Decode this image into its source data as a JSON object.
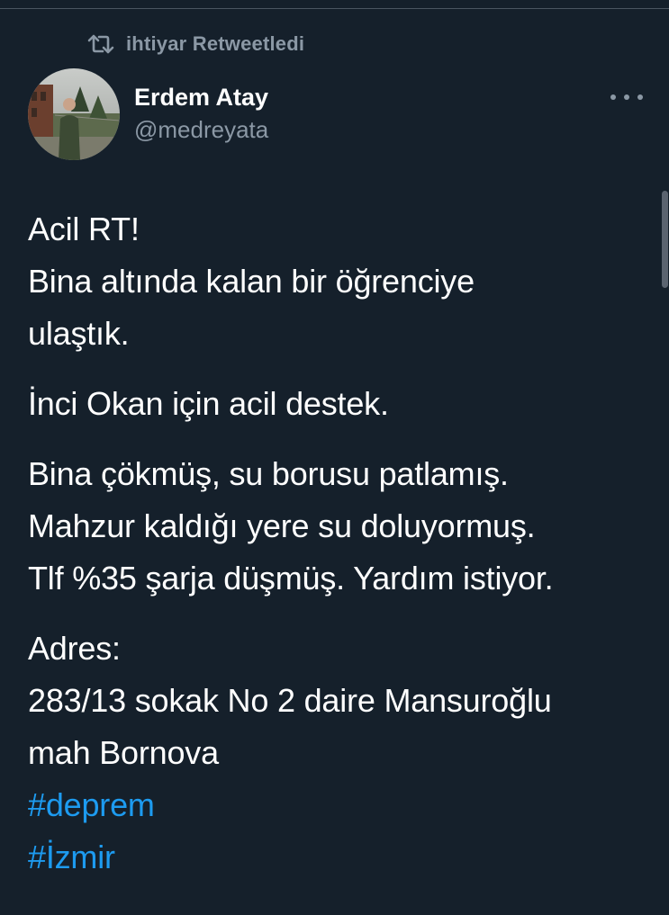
{
  "retweet": {
    "icon": "retweet-icon",
    "label": "ihtiyar Retweetledi"
  },
  "author": {
    "display_name": "Erdem Atay",
    "handle": "@medreyata",
    "avatar_icon": "avatar-photo"
  },
  "more_icon": "more-horizontal-icon",
  "tweet": {
    "paragraph1": {
      "line1": "Acil RT!",
      "line2": "Bina altında kalan bir öğrenciye",
      "line3": "ulaştık."
    },
    "paragraph2": {
      "line1": "İnci Okan için acil destek."
    },
    "paragraph3": {
      "line1": "Bina çökmüş, su borusu patlamış.",
      "line2": "Mahzur kaldığı yere su doluyormuş.",
      "line3": "Tlf %35 şarja düşmüş. Yardım istiyor."
    },
    "paragraph4": {
      "line1": "Adres:",
      "line2": "283/13 sokak No 2 daire Mansuroğlu",
      "line3": "mah Bornova"
    },
    "hashtags": [
      "#deprem",
      "#İzmir"
    ]
  },
  "colors": {
    "background": "#15202b",
    "text": "#ffffff",
    "secondary": "#8b98a5",
    "link": "#1d9bf0"
  }
}
